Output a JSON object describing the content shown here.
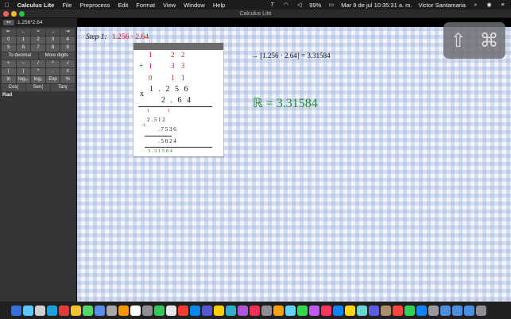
{
  "menubar": {
    "app": "Calculus Lite",
    "items": [
      "File",
      "Preprocess",
      "Edit",
      "Format",
      "View",
      "Window",
      "Help"
    ],
    "battery": "99%",
    "datetime": "Mar 9 de jul  10:35:31 a. m.",
    "user": "Victor Santamaria"
  },
  "window": {
    "title": "Calculus Lite"
  },
  "toolbar": {
    "segment_label": "◂ ▸",
    "input_value": "1.256*2.64"
  },
  "keypad": {
    "rows": [
      [
        "⇤",
        "←",
        "=",
        "→",
        "⇥"
      ],
      [
        "0",
        "1",
        "2",
        "3",
        "4"
      ],
      [
        "5",
        "6",
        "7",
        "8",
        "9"
      ],
      [
        "To decimal",
        "More digits"
      ],
      [
        "+",
        "−",
        "/",
        "^",
        "√"
      ],
      [
        "(",
        ")",
        "*",
        ".",
        "≡"
      ],
      [
        "ln",
        "log₁₀",
        "log₂",
        "Exp",
        "%"
      ],
      [
        "Cos(",
        "Sen(",
        "Tan("
      ]
    ],
    "mode": "Rad"
  },
  "canvas": {
    "step_label": "Step 1:",
    "step_expr": "1.256 · 2.64",
    "equation": "→ [1.256 · 2.64] = 3.31584",
    "result": "ℝ = 3.31584",
    "work": {
      "carry1": [
        "1",
        "2",
        "2"
      ],
      "plus": "+",
      "carry2": [
        "1",
        "3",
        "3"
      ],
      "carry3": [
        "0",
        "1",
        "1"
      ],
      "times": "x",
      "top": "1 . 2 5 6",
      "bottom": "2 . 6 4",
      "small_carry": [
        "1",
        "1"
      ],
      "partial1": "2 .  5  1  2",
      "plus_small": "+",
      "partial2": ".  7  5  3  6",
      "partial3": ".   5  0  2  4",
      "answer": "3  .  3  1  5  8  4"
    }
  },
  "colors": {
    "accent_red": "#d21a1a",
    "accent_green": "#1b8a2a",
    "panel": "#353535"
  }
}
